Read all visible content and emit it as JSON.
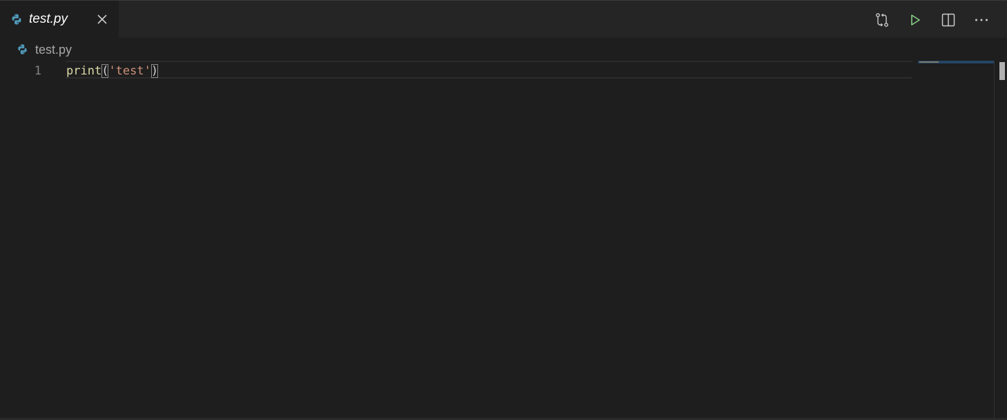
{
  "tab": {
    "label": "test.py",
    "icon": "python-icon",
    "close_icon": "close-icon"
  },
  "actions": [
    {
      "name": "open-changes-button",
      "icon": "git-compare-icon"
    },
    {
      "name": "run-python-file-button",
      "icon": "play-icon"
    },
    {
      "name": "split-editor-button",
      "icon": "split-editor-icon"
    },
    {
      "name": "more-actions-button",
      "icon": "ellipsis-icon"
    }
  ],
  "breadcrumb": {
    "label": "test.py",
    "icon": "python-icon"
  },
  "editor": {
    "line_number": "1",
    "code": {
      "fn": "print",
      "open_paren": "(",
      "string": "'test'",
      "close_paren": ")"
    }
  },
  "colors": {
    "editor_bg": "#1e1e1e",
    "tabbar_bg": "#252526",
    "function": "#dcdcaa",
    "string": "#ce9178",
    "run_green": "#89d185",
    "python_blue": "#519aba"
  }
}
